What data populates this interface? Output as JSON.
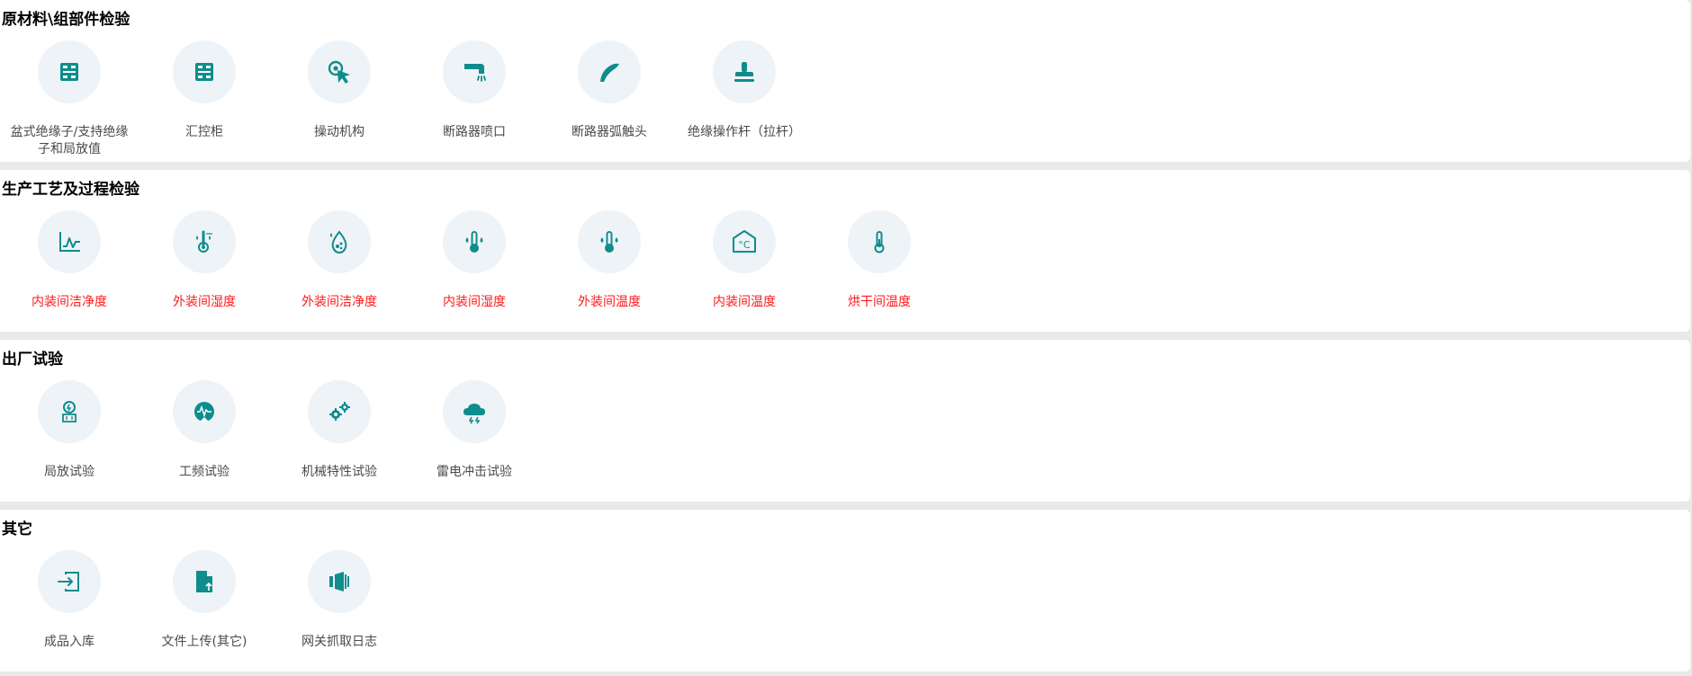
{
  "theme": {
    "icon_color": "#0f8c8c",
    "alert_color": "#ff1a1a",
    "panel_bg": "#ffffff",
    "page_bg": "#e9e9e9"
  },
  "sections": [
    {
      "title": "原材料\\组部件检验",
      "items": [
        {
          "label": "盆式绝缘子/支持绝缘子和局放值",
          "icon": "switchgear-icon",
          "alert": false
        },
        {
          "label": "汇控柜",
          "icon": "control-cabinet-icon",
          "alert": false
        },
        {
          "label": "操动机构",
          "icon": "pointer-click-icon",
          "alert": false
        },
        {
          "label": "断路器喷口",
          "icon": "nozzle-icon",
          "alert": false
        },
        {
          "label": "断路器弧触头",
          "icon": "arc-contact-icon",
          "alert": false
        },
        {
          "label": "绝缘操作杆（拉杆）",
          "icon": "stamp-icon",
          "alert": false
        }
      ]
    },
    {
      "title": "生产工艺及过程检验",
      "items": [
        {
          "label": "内装间洁净度",
          "icon": "line-chart-icon",
          "alert": true
        },
        {
          "label": "外装间湿度",
          "icon": "thermometer-humidity-icon",
          "alert": true
        },
        {
          "label": "外装间洁净度",
          "icon": "water-drop-icon",
          "alert": true
        },
        {
          "label": "内装间湿度",
          "icon": "thermometer-drops-icon",
          "alert": true
        },
        {
          "label": "外装间温度",
          "icon": "thermometer-drops-icon",
          "alert": true
        },
        {
          "label": "内装间温度",
          "icon": "room-celsius-icon",
          "alert": true
        },
        {
          "label": "烘干间温度",
          "icon": "thermometer-icon",
          "alert": true
        }
      ]
    },
    {
      "title": "出厂试验",
      "items": [
        {
          "label": "局放试验",
          "icon": "partial-discharge-icon",
          "alert": false
        },
        {
          "label": "工频试验",
          "icon": "power-frequency-icon",
          "alert": false
        },
        {
          "label": "机械特性试验",
          "icon": "gears-icon",
          "alert": false
        },
        {
          "label": "雷电冲击试验",
          "icon": "thunder-cloud-icon",
          "alert": false
        }
      ]
    },
    {
      "title": "其它",
      "items": [
        {
          "label": "成品入库",
          "icon": "login-icon",
          "alert": false
        },
        {
          "label": "文件上传(其它)",
          "icon": "file-upload-icon",
          "alert": false
        },
        {
          "label": "网关抓取日志",
          "icon": "gateway-log-icon",
          "alert": false
        }
      ]
    }
  ]
}
